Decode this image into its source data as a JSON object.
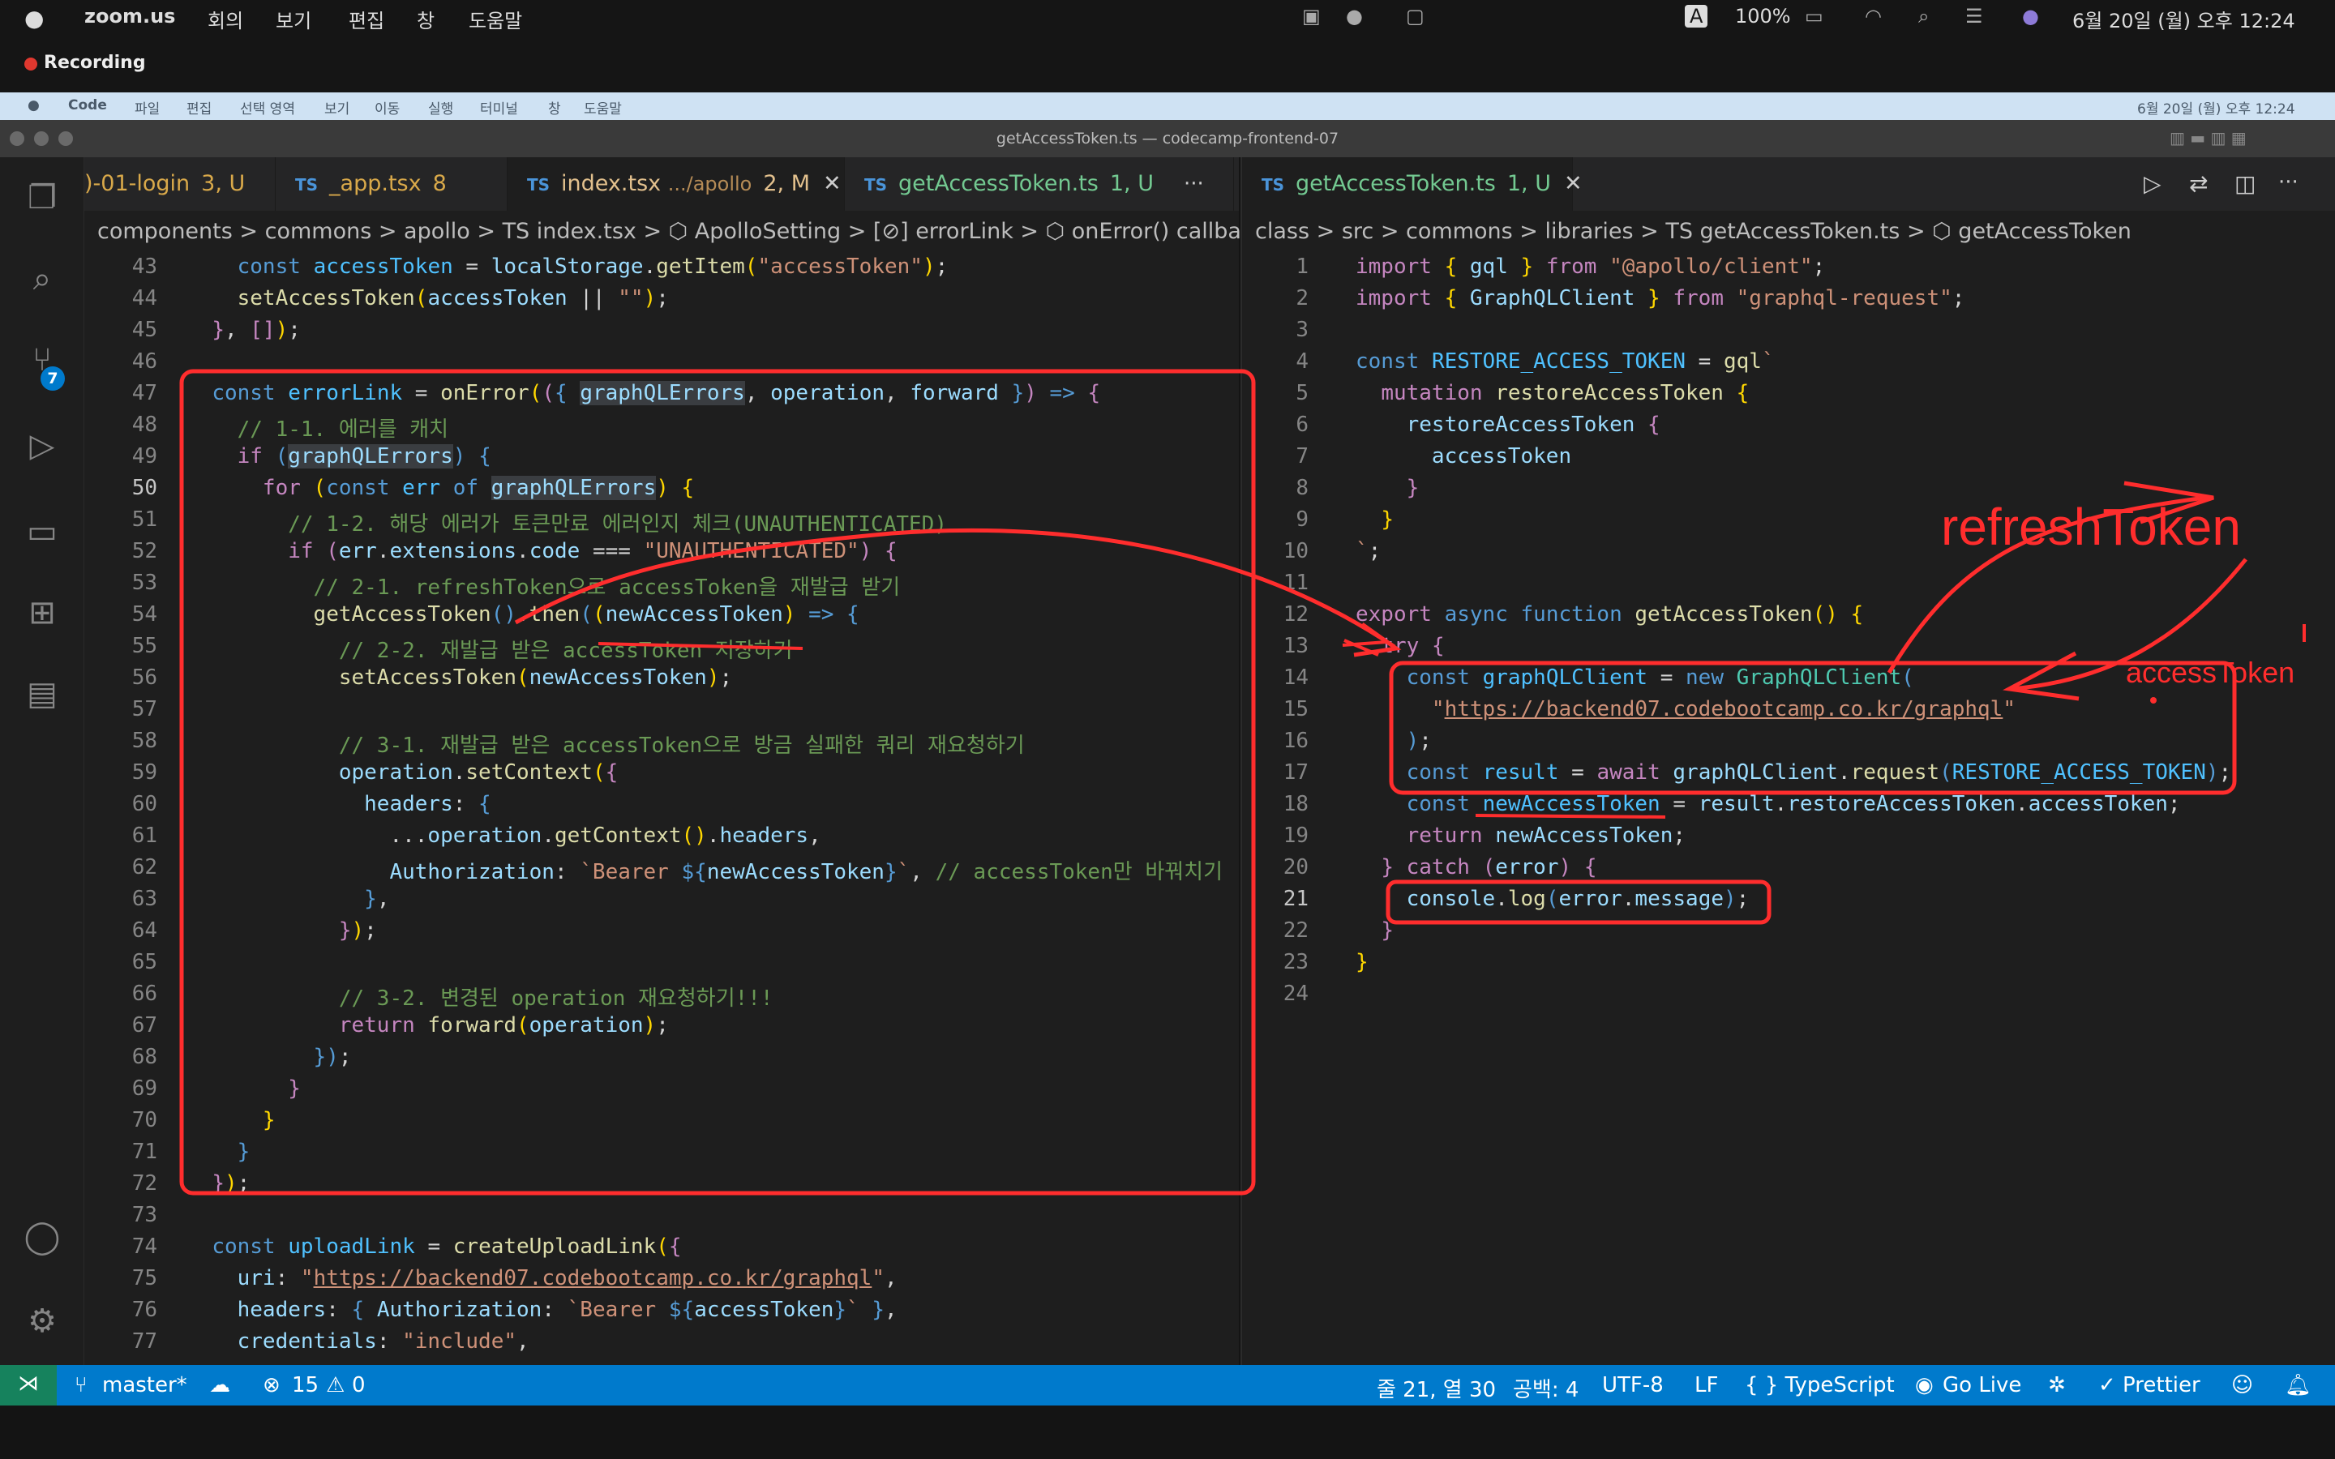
{
  "zoom_menubar": {
    "app": "zoom.us",
    "menus": [
      "회의",
      "보기",
      "편집",
      "창",
      "도움말"
    ],
    "status_right": "6월 20일 (월) 오후 12:24",
    "battery": "100%",
    "recording_label": "Recording"
  },
  "mac_menubar": {
    "app": "Code",
    "menus": [
      "파일",
      "편집",
      "선택 영역",
      "보기",
      "이동",
      "실행",
      "터미널",
      "창",
      "도움말"
    ],
    "datetime": "6월 20일 (월) 오후 12:24"
  },
  "window": {
    "title": "getAccessToken.ts — codecamp-frontend-07"
  },
  "activity_bar": {
    "scm_badge": "7"
  },
  "left_editor": {
    "tabs": [
      {
        "label": ")-01-login",
        "status": "3, U",
        "icon": ""
      },
      {
        "label": "_app.tsx",
        "status": "8",
        "icon": "TS"
      },
      {
        "label": "index.tsx",
        "desc": ".../apollo",
        "status": "2, M",
        "icon": "TS"
      },
      {
        "label": "getAccessToken.ts",
        "status": "1, U",
        "icon": "TS"
      }
    ],
    "more": "···",
    "breadcrumb": "components > commons > apollo > TS index.tsx > ⬡ ApolloSetting > [⊘] errorLink > ⬡ onError() callback"
  },
  "right_editor": {
    "tab": {
      "label": "getAccessToken.ts",
      "status": "1, U",
      "icon": "TS"
    },
    "breadcrumb": "class > src > commons > libraries > TS getAccessToken.ts > ⬡ getAccessToken"
  },
  "annotations": {
    "refresh": "refreshToken",
    "access": "accessToken"
  },
  "statusbar": {
    "branch": "master*",
    "errors": "15",
    "warnings": "0",
    "position": "줄 21, 열 30",
    "spaces": "공백: 4",
    "encoding": "UTF-8",
    "eol": "LF",
    "language": "{ } TypeScript",
    "golive": "Go Live",
    "prettier": "✓ Prettier"
  },
  "colors": {
    "statusbar": "#007acc",
    "annotation": "#ff2d2d",
    "editor_bg": "#1e1e1e"
  }
}
